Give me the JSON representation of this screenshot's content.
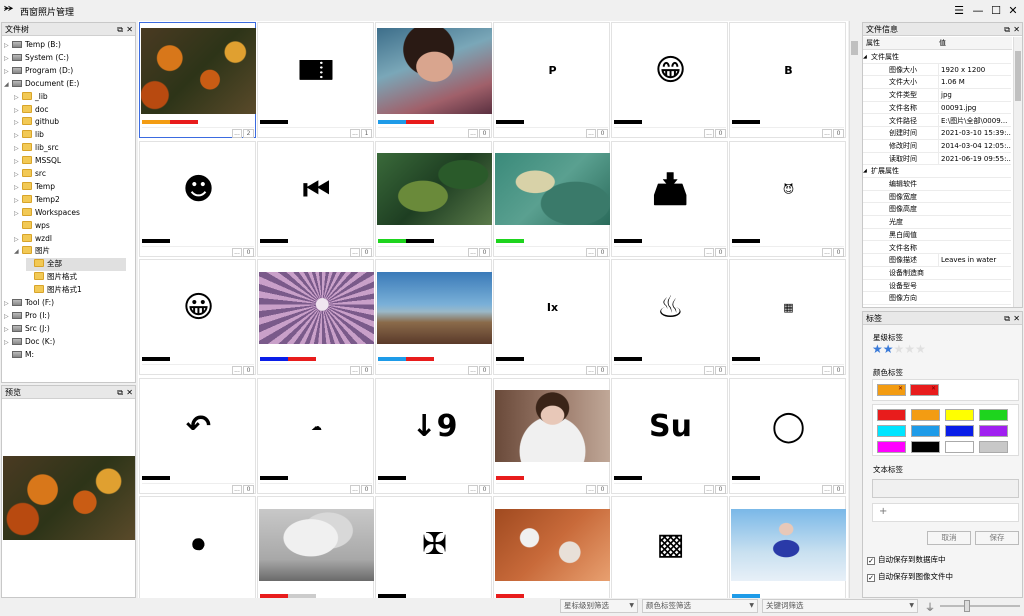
{
  "app": {
    "logo": "TITLE",
    "title": "西窗照片管理"
  },
  "left_tree": {
    "title": "文件树",
    "rows": [
      {
        "label": "Temp (B:)",
        "type": "drive",
        "arrow": "▷"
      },
      {
        "label": "System (C:)",
        "type": "drive",
        "arrow": "▷"
      },
      {
        "label": "Program (D:)",
        "type": "drive",
        "arrow": "▷"
      },
      {
        "label": "Document (E:)",
        "type": "drive",
        "arrow": "◢"
      },
      {
        "label": "_lib",
        "type": "folder",
        "arrow": "▷"
      },
      {
        "label": "doc",
        "type": "folder",
        "arrow": "▷"
      },
      {
        "label": "github",
        "type": "folder",
        "arrow": "▷"
      },
      {
        "label": "lib",
        "type": "folder",
        "arrow": "▷"
      },
      {
        "label": "lib_src",
        "type": "folder",
        "arrow": "▷"
      },
      {
        "label": "MSSQL",
        "type": "folder",
        "arrow": "▷"
      },
      {
        "label": "src",
        "type": "folder",
        "arrow": "▷"
      },
      {
        "label": "Temp",
        "type": "folder",
        "arrow": "▷"
      },
      {
        "label": "Temp2",
        "type": "folder",
        "arrow": "▷"
      },
      {
        "label": "Workspaces",
        "type": "folder",
        "arrow": "▷"
      },
      {
        "label": "wps",
        "type": "folder",
        "arrow": ""
      },
      {
        "label": "wzdl",
        "type": "folder",
        "arrow": "▷"
      },
      {
        "label": "图片",
        "type": "folder",
        "arrow": "◢"
      },
      {
        "label": "全部",
        "type": "folder",
        "arrow": "",
        "selected": true
      },
      {
        "label": "图片格式",
        "type": "folder",
        "arrow": ""
      },
      {
        "label": "图片格式1",
        "type": "folder",
        "arrow": ""
      },
      {
        "label": "Tool (F:)",
        "type": "drive",
        "arrow": "▷"
      },
      {
        "label": "Pro (I:)",
        "type": "drive",
        "arrow": "▷"
      },
      {
        "label": "Src (J:)",
        "type": "drive",
        "arrow": "▷"
      },
      {
        "label": "Doc (K:)",
        "type": "drive",
        "arrow": "▷"
      },
      {
        "label": "M:",
        "type": "drive",
        "arrow": ""
      }
    ]
  },
  "preview": {
    "title": "预览"
  },
  "grid": {
    "cells": [
      {
        "kind": "photo-autumn",
        "bars": [
          "#f39c12",
          "#e81c1c"
        ],
        "b1": "...",
        "b2": "2",
        "active": true
      },
      {
        "kind": "icon",
        "glyph": "🎫",
        "bars": [
          "#000"
        ],
        "b1": "...",
        "b2": "1"
      },
      {
        "kind": "photo-woman",
        "bars": [
          "#1e9be8",
          "#e81c1c"
        ],
        "b1": "...",
        "b2": "0"
      },
      {
        "kind": "icon",
        "glyph": "P",
        "bars": [
          "#000"
        ],
        "b1": "...",
        "b2": "0",
        "small": true
      },
      {
        "kind": "icon",
        "glyph": "😁",
        "bars": [
          "#000"
        ],
        "b1": "...",
        "b2": "0"
      },
      {
        "kind": "icon",
        "glyph": "B",
        "bars": [
          "#000"
        ],
        "b1": "...",
        "b2": "0",
        "small": true
      },
      {
        "kind": "icon",
        "glyph": "☻",
        "bars": [
          "#000"
        ],
        "b1": "...",
        "b2": "0"
      },
      {
        "kind": "icon",
        "glyph": "⏮",
        "bars": [
          "#000"
        ],
        "b1": "...",
        "b2": "0"
      },
      {
        "kind": "photo-aerial",
        "bars": [
          "#1ed41e",
          "#000"
        ],
        "b1": "...",
        "b2": "0"
      },
      {
        "kind": "photo-sea",
        "bars": [
          "#1ed41e"
        ],
        "b1": "...",
        "b2": "0"
      },
      {
        "kind": "icon",
        "glyph": "📥",
        "bars": [
          "#000"
        ],
        "b1": "...",
        "b2": "0"
      },
      {
        "kind": "icon",
        "glyph": "😈",
        "bars": [
          "#000"
        ],
        "b1": "...",
        "b2": "0",
        "small": true
      },
      {
        "kind": "icon",
        "glyph": "😀",
        "bars": [
          "#000"
        ],
        "b1": "...",
        "b2": "0"
      },
      {
        "kind": "photo-flower",
        "bars": [
          "#0a1ee8",
          "#e81c1c"
        ],
        "b1": "...",
        "b2": "0"
      },
      {
        "kind": "photo-beach",
        "bars": [
          "#1e9be8",
          "#e81c1c"
        ],
        "b1": "...",
        "b2": "0"
      },
      {
        "kind": "icon",
        "glyph": "Ix",
        "bars": [
          "#000"
        ],
        "b1": "...",
        "b2": "0",
        "small": true
      },
      {
        "kind": "icon",
        "glyph": "♨",
        "bars": [
          "#000"
        ],
        "b1": "...",
        "b2": "0"
      },
      {
        "kind": "icon",
        "glyph": "▦",
        "bars": [
          "#000"
        ],
        "b1": "...",
        "b2": "0",
        "small": true
      },
      {
        "kind": "icon",
        "glyph": "↶",
        "bars": [
          "#000"
        ],
        "b1": "...",
        "b2": "0"
      },
      {
        "kind": "icon",
        "glyph": "☁",
        "bars": [
          "#000"
        ],
        "b1": "...",
        "b2": "0",
        "small": true
      },
      {
        "kind": "icon",
        "glyph": "↓9",
        "bars": [
          "#000"
        ],
        "b1": "...",
        "b2": "0"
      },
      {
        "kind": "photo-girl",
        "bars": [
          "#e81c1c"
        ],
        "b1": "...",
        "b2": "0"
      },
      {
        "kind": "icon",
        "glyph": "Su",
        "bars": [
          "#000"
        ],
        "b1": "...",
        "b2": "0"
      },
      {
        "kind": "icon",
        "glyph": "◯",
        "bars": [
          "#000"
        ],
        "b1": "...",
        "b2": "0"
      },
      {
        "kind": "icon",
        "glyph": "⚽",
        "bars": [],
        "b1": "",
        "b2": "",
        "small": true
      },
      {
        "kind": "photo-tree",
        "bars": [
          "#e81c1c",
          "#cccccc"
        ],
        "b1": "",
        "b2": ""
      },
      {
        "kind": "icon",
        "glyph": "✠",
        "bars": [
          "#000"
        ],
        "b1": "",
        "b2": ""
      },
      {
        "kind": "photo-snow",
        "bars": [
          "#e81c1c"
        ],
        "b1": "",
        "b2": ""
      },
      {
        "kind": "icon",
        "glyph": "▩",
        "bars": [],
        "b1": "",
        "b2": ""
      },
      {
        "kind": "photo-model",
        "bars": [
          "#1e9be8"
        ],
        "b1": "",
        "b2": ""
      }
    ]
  },
  "file_info": {
    "title": "文件信息",
    "col_key": "属性",
    "col_val": "值",
    "rows": [
      {
        "group": "文件属性"
      },
      {
        "k": "图像大小",
        "v": "1920 x 1200"
      },
      {
        "k": "文件大小",
        "v": "1.06 M"
      },
      {
        "k": "文件类型",
        "v": "jpg"
      },
      {
        "k": "文件名称",
        "v": "00091.jpg"
      },
      {
        "k": "文件路径",
        "v": "E:\\图片\\全部\\0009..."
      },
      {
        "k": "创建时间",
        "v": "2021-03-10 15:39:..."
      },
      {
        "k": "修改时间",
        "v": "2014-03-04 12:05:..."
      },
      {
        "k": "读取时间",
        "v": "2021-06-19 09:55:..."
      },
      {
        "group": "扩展属性"
      },
      {
        "k": "编辑软件",
        "v": ""
      },
      {
        "k": "图像宽度",
        "v": ""
      },
      {
        "k": "图像高度",
        "v": ""
      },
      {
        "k": "光度",
        "v": ""
      },
      {
        "k": "黑白阈值",
        "v": ""
      },
      {
        "k": "文件名称",
        "v": ""
      },
      {
        "k": "图像描述",
        "v": "Leaves in water"
      },
      {
        "k": "设备制造商",
        "v": ""
      },
      {
        "k": "设备型号",
        "v": ""
      },
      {
        "k": "图像方向",
        "v": ""
      }
    ]
  },
  "tags": {
    "title": "标签",
    "star_label": "星级标签",
    "stars": {
      "rating": 2,
      "max": 5
    },
    "color_label": "颜色标签",
    "selected_colors": [
      "#f39c12",
      "#e81c1c"
    ],
    "palette": [
      "#e81c1c",
      "#f39c12",
      "#ffff00",
      "#1ed41e",
      "#00e5ff",
      "#1e9be8",
      "#0a1ee8",
      "#a020f0",
      "#ff00ff",
      "#000000",
      "#ffffff",
      "#c8c8c8"
    ],
    "text_label": "文本标签",
    "add": "+",
    "cancel": "取消",
    "save": "保存",
    "auto_db": "自动保存到数据库中",
    "auto_file": "自动保存到图像文件中"
  },
  "bottom": {
    "star_filter": "星标级别筛选",
    "color_filter": "颜色标签筛选",
    "keyword_filter": "关键词筛选"
  }
}
